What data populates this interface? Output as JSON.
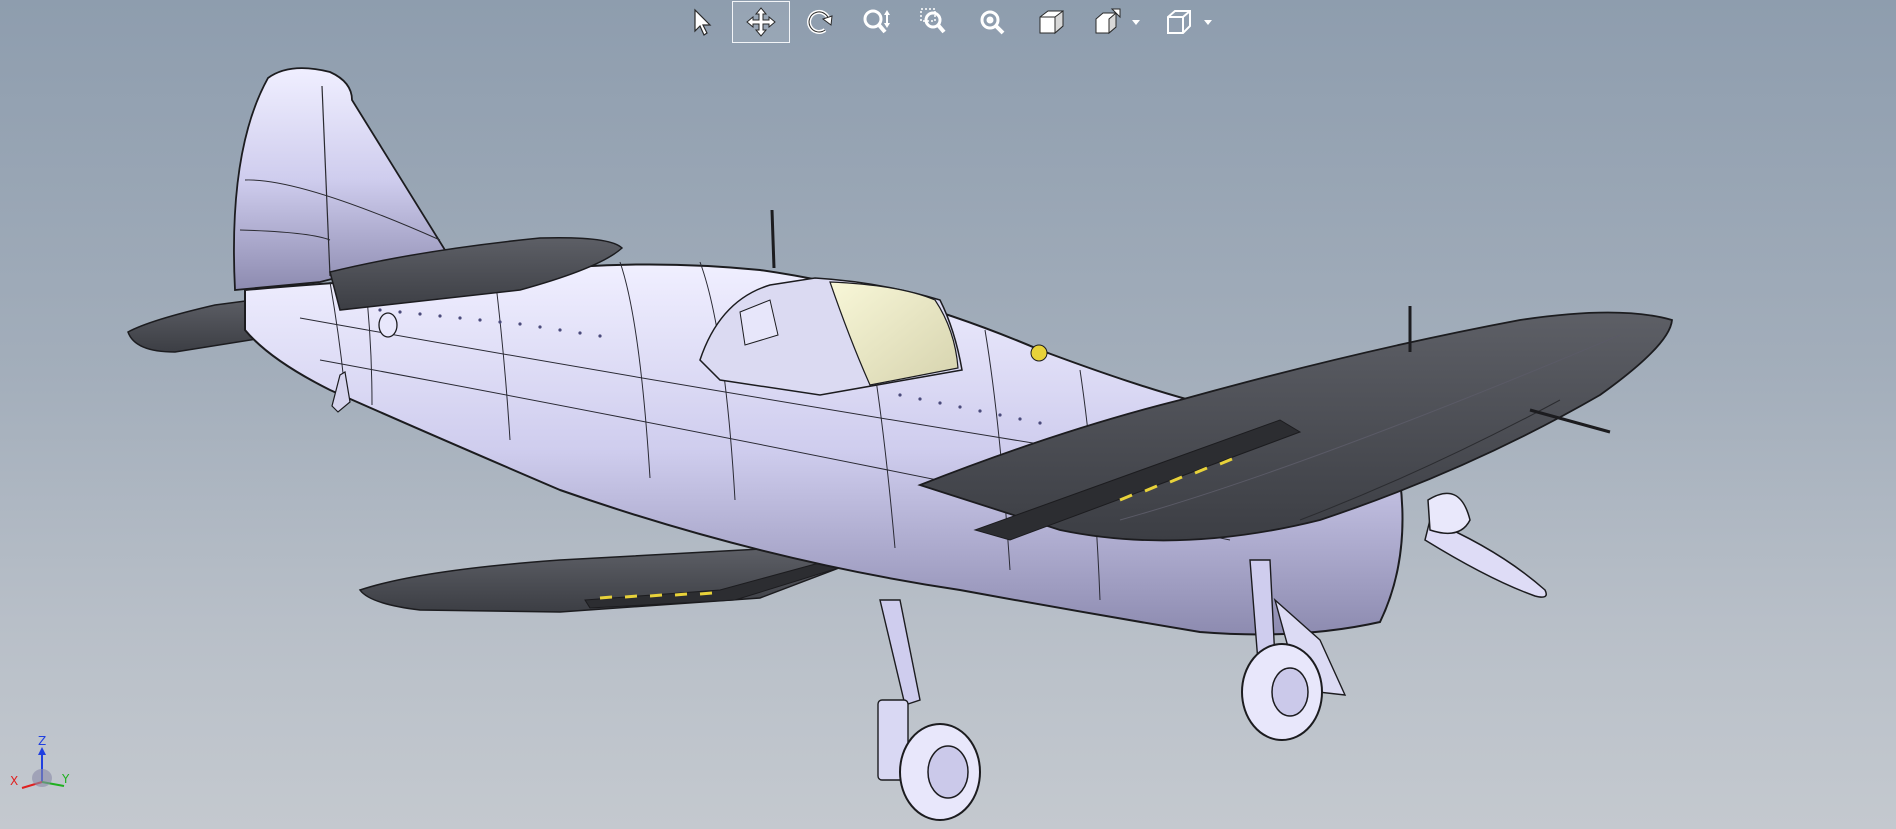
{
  "toolbar": {
    "tools": [
      {
        "name": "select",
        "icon": "arrow-pointer-icon",
        "active": false
      },
      {
        "name": "pan",
        "icon": "pan-move-icon",
        "active": true
      },
      {
        "name": "rotate",
        "icon": "rotate-icon",
        "active": false
      },
      {
        "name": "zoom",
        "icon": "zoom-in-out-icon",
        "active": false
      },
      {
        "name": "zoom-window",
        "icon": "zoom-window-icon",
        "active": false
      },
      {
        "name": "zoom-fit",
        "icon": "zoom-fit-icon",
        "active": false
      },
      {
        "name": "shaded-view",
        "icon": "shaded-cube-icon",
        "active": false
      },
      {
        "name": "standard-views",
        "icon": "view-orientation-icon",
        "active": false
      },
      {
        "name": "display-style",
        "icon": "wireframe-cube-icon",
        "active": false
      }
    ]
  },
  "triad": {
    "z_label": "Z",
    "x_label": "X",
    "y_label": "Y"
  },
  "colors": {
    "background_top": "#8e9dae",
    "background_bottom": "#c4c9cf",
    "model_body": "#d8d6f2",
    "model_dark": "#4a4c52",
    "accent_yellow": "#e8d23a",
    "axis_x": "#e02020",
    "axis_y": "#20b020",
    "axis_z": "#2040e0"
  }
}
